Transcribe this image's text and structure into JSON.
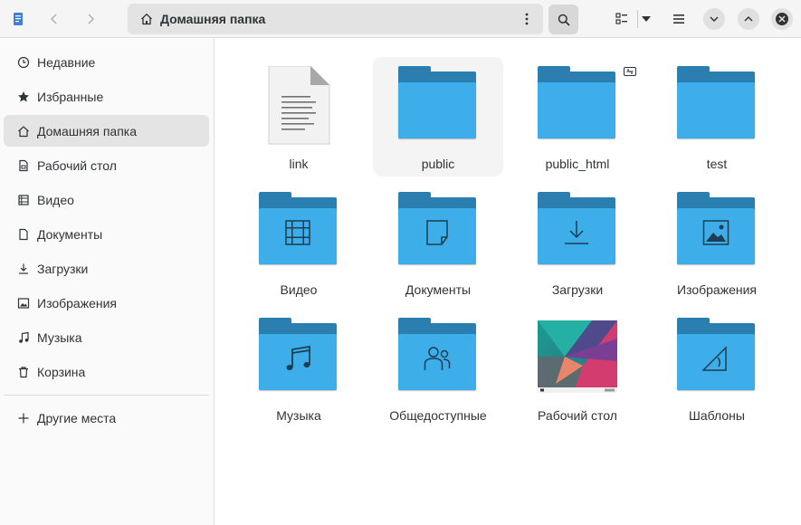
{
  "header": {
    "path_label": "Домашняя папка",
    "path_icon": "home-icon",
    "app_icon": "file-manager-icon",
    "back_icon": "chevron-left-icon",
    "forward_icon": "chevron-right-icon",
    "menu_icon": "vertical-dots-icon",
    "search_icon": "search-icon",
    "view_icon": "grid-view-icon",
    "view_dropdown_icon": "triangle-down-icon",
    "hamburger_icon": "hamburger-icon",
    "minimize_icon": "chevron-down-icon",
    "maximize_icon": "chevron-up-icon",
    "close_icon": "close-icon"
  },
  "sidebar": {
    "items": [
      {
        "label": "Недавние",
        "icon": "clock-icon"
      },
      {
        "label": "Избранные",
        "icon": "star-icon"
      },
      {
        "label": "Домашняя папка",
        "icon": "home-icon"
      },
      {
        "label": "Рабочий стол",
        "icon": "desktop-icon"
      },
      {
        "label": "Видео",
        "icon": "video-icon"
      },
      {
        "label": "Документы",
        "icon": "document-icon"
      },
      {
        "label": "Загрузки",
        "icon": "download-icon"
      },
      {
        "label": "Изображения",
        "icon": "image-icon"
      },
      {
        "label": "Музыка",
        "icon": "music-icon"
      },
      {
        "label": "Корзина",
        "icon": "trash-icon"
      }
    ],
    "other_places": {
      "label": "Другие места",
      "icon": "plus-icon"
    }
  },
  "files": [
    {
      "label": "link",
      "type": "text-file"
    },
    {
      "label": "public",
      "type": "folder"
    },
    {
      "label": "public_html",
      "type": "folder-linked"
    },
    {
      "label": "test",
      "type": "folder"
    },
    {
      "label": "Видео",
      "type": "folder-video"
    },
    {
      "label": "Документы",
      "type": "folder-documents"
    },
    {
      "label": "Загрузки",
      "type": "folder-downloads"
    },
    {
      "label": "Изображения",
      "type": "folder-pictures"
    },
    {
      "label": "Музыка",
      "type": "folder-music"
    },
    {
      "label": "Общедоступные",
      "type": "folder-public"
    },
    {
      "label": "Рабочий стол",
      "type": "desktop-thumbnail"
    },
    {
      "label": "Шаблоны",
      "type": "folder-templates"
    }
  ],
  "colors": {
    "folder_front": "#3daee9",
    "folder_back": "#2a7fb0",
    "accent": "#3daee9"
  }
}
